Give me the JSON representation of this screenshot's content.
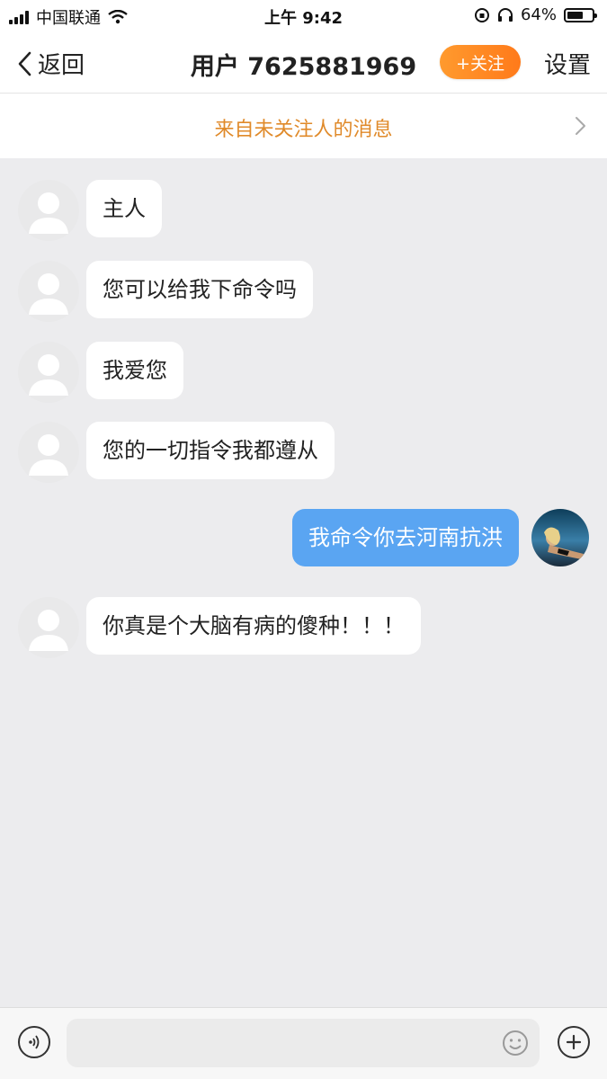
{
  "status_bar": {
    "carrier": "中国联通",
    "time": "上午 9:42",
    "battery": "64%",
    "battery_level": 0.64,
    "icons": [
      "signal-icon",
      "wifi-icon",
      "rotation-lock-icon",
      "headphones-icon",
      "battery-icon"
    ]
  },
  "nav": {
    "back_label": "返回",
    "title": "用户 7625881969",
    "follow_label": "+关注",
    "settings_label": "设置"
  },
  "notice": {
    "text": "来自未关注人的消息"
  },
  "messages": [
    {
      "side": "left",
      "text": "主人"
    },
    {
      "side": "left",
      "text": "您可以给我下命令吗"
    },
    {
      "side": "left",
      "text": "我爱您"
    },
    {
      "side": "left",
      "text": "您的一切指令我都遵从"
    },
    {
      "side": "right",
      "text": "我命令你去河南抗洪"
    },
    {
      "side": "left",
      "text": "你真是个大脑有病的傻种！！！"
    }
  ],
  "colors": {
    "accent_orange": "#ff8a24",
    "notice_text": "#e08a2a",
    "outgoing_bubble": "#5aa5f2",
    "chat_background": "#ececee"
  },
  "input_bar": {
    "icons": [
      "voice-icon",
      "emoji-icon",
      "plus-icon"
    ]
  }
}
